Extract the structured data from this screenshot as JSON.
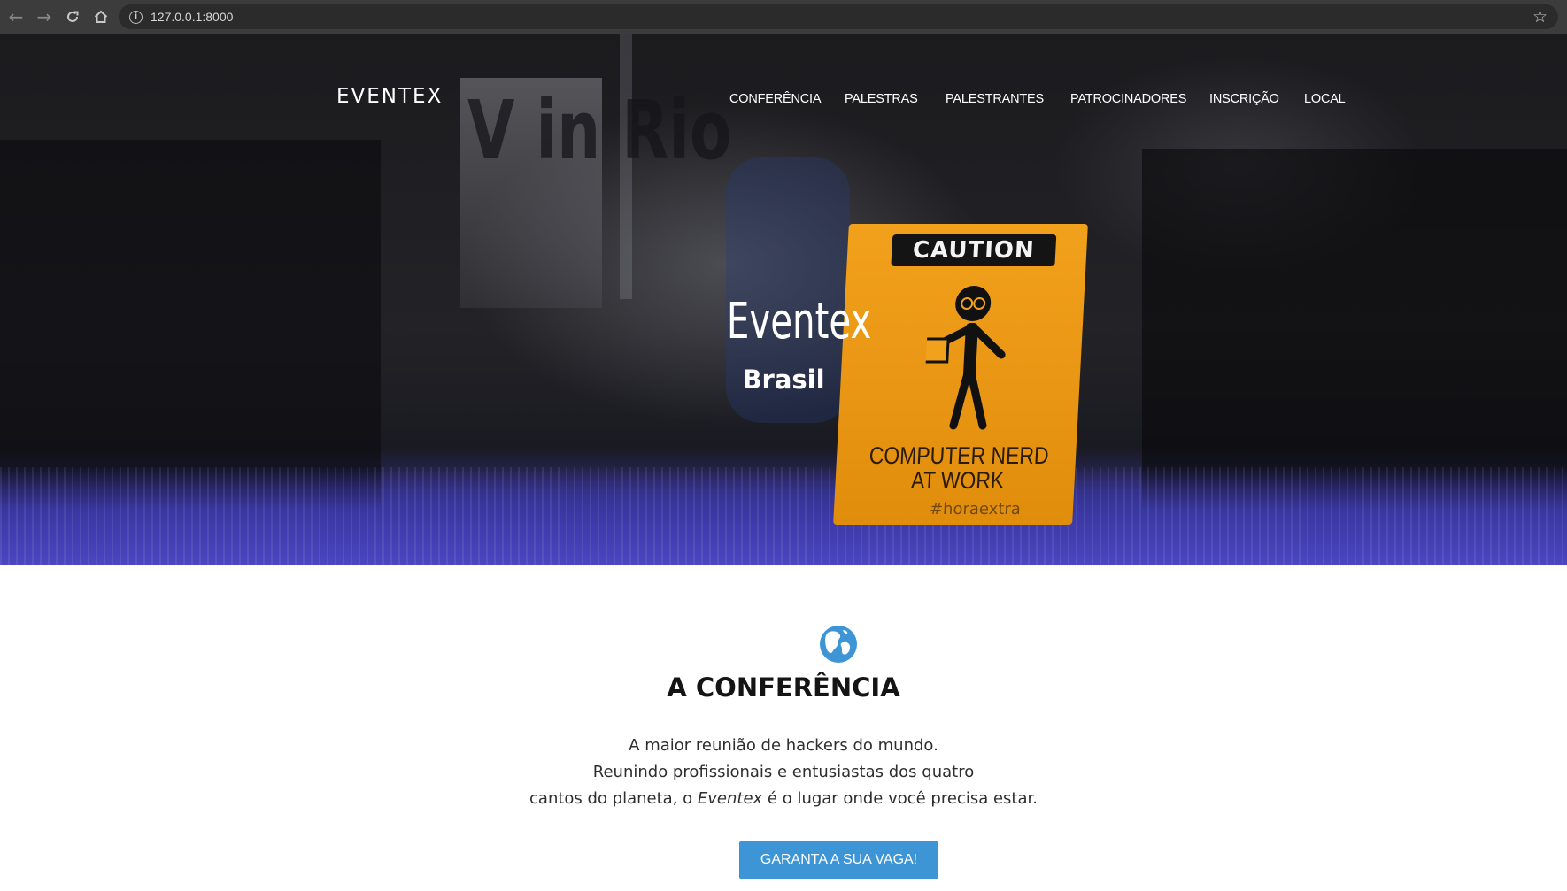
{
  "browser": {
    "back_icon": "arrow-left-icon",
    "forward_icon": "arrow-right-icon",
    "reload_icon": "reload-icon",
    "home_icon": "home-icon",
    "url": "127.0.0.1:8000",
    "bookmark_icon": "star-icon"
  },
  "header": {
    "logo": "EVENTEX",
    "nav": [
      {
        "label": "CONFERÊNCIA"
      },
      {
        "label": "PALESTRAS"
      },
      {
        "label": "PALESTRANTES"
      },
      {
        "label": "PATROCINADORES"
      },
      {
        "label": "INSCRIÇÃO"
      },
      {
        "label": "LOCAL"
      }
    ]
  },
  "hero": {
    "title": "Eventex",
    "subtitle": "Brasil",
    "background": {
      "banner_text": "V in Rio",
      "sign_header": "CAUTION",
      "sign_line1": "COMPUTER NERD",
      "sign_line2": "AT WORK",
      "sign_tag": "#horaextra"
    }
  },
  "conference": {
    "icon": "globe-icon",
    "title": "A CONFERÊNCIA",
    "line1": "A maior reunião de hackers do mundo.",
    "line2": "Reunindo profissionais e entusiastas dos quatro",
    "line3_before": "cantos do planeta, o ",
    "line3_emphasis": "Eventex",
    "line3_after": " é o lugar onde você precisa estar.",
    "cta_label": "GARANTA A SUA VAGA!"
  },
  "colors": {
    "accent": "#3d95d6",
    "browser_bar": "#3c3c3c",
    "sign_orange": "#f2a11c",
    "floor_blue": "#4a46c0"
  }
}
